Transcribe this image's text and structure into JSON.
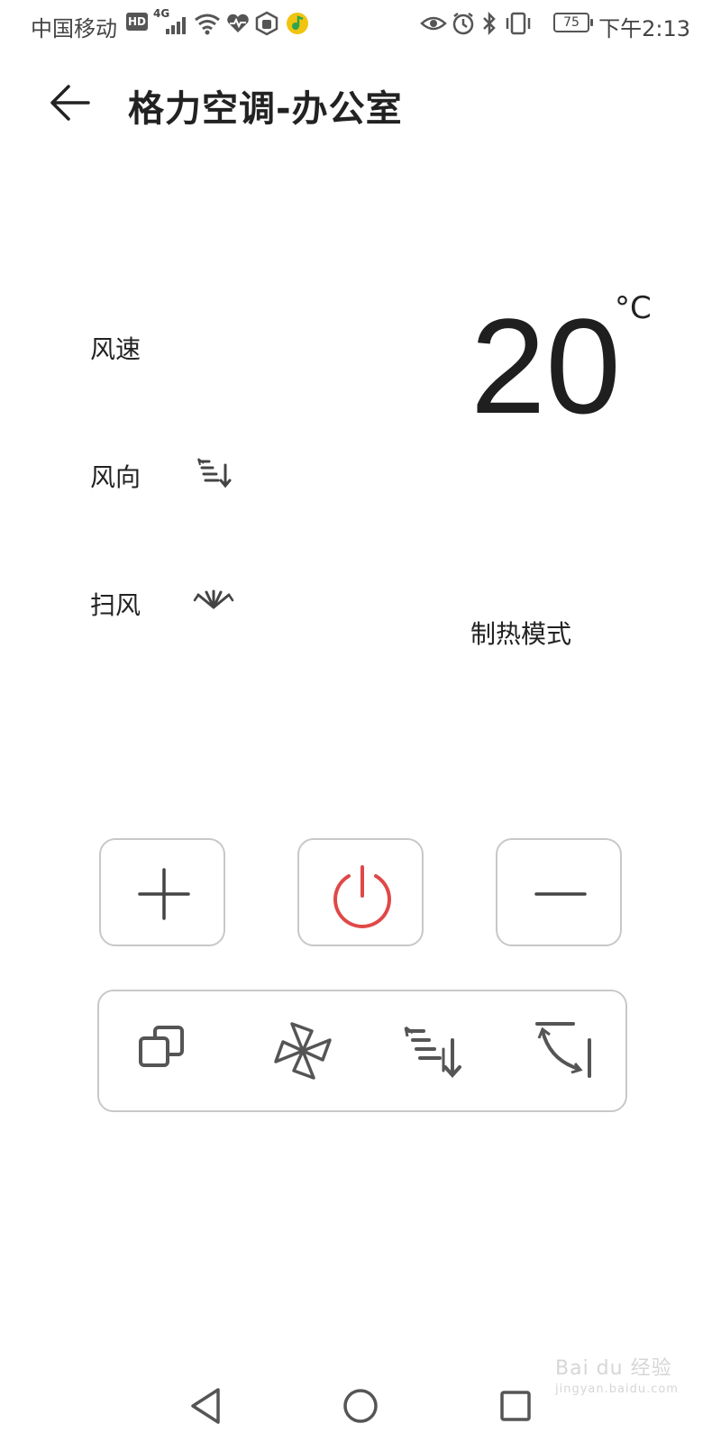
{
  "status_bar": {
    "carrier": "中国移动",
    "hd": "HD",
    "network": "4G",
    "battery": "75",
    "time": "下午2:13"
  },
  "header": {
    "title": "格力空调-办公室"
  },
  "controls": {
    "wind_speed_label": "风速",
    "wind_direction_label": "风向",
    "swing_label": "扫风"
  },
  "display": {
    "temperature": "20",
    "unit": "°C",
    "mode": "制热模式"
  },
  "colors": {
    "power_accent": "#e04848",
    "icon_gray": "#555555",
    "border": "#c8c8c8"
  },
  "watermark": {
    "text": "Bai du 经验",
    "sub": "jingyan.baidu.com"
  }
}
